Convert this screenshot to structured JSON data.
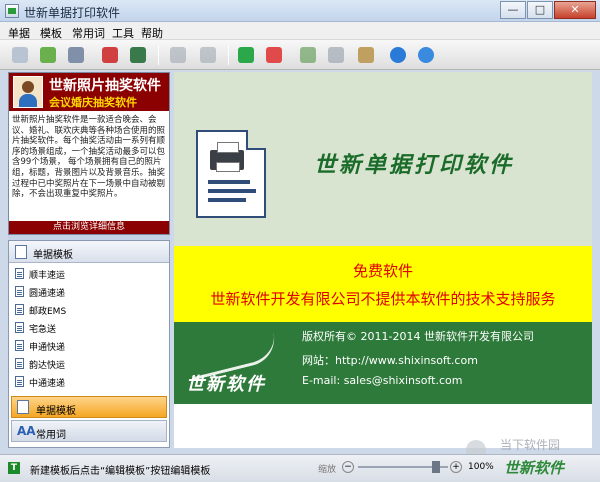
{
  "window": {
    "title": "世新单据打印软件"
  },
  "menu": [
    "单据",
    "模板",
    "常用词",
    "工具",
    "帮助"
  ],
  "toolbar": {
    "icons": [
      "edit-icon",
      "approve-icon",
      "print-icon",
      "delete-red-icon",
      "database-icon",
      "settings-icon",
      "save-icon",
      "add-icon",
      "remove-icon",
      "font-up-icon",
      "font-down-icon",
      "tools-icon",
      "help-icon",
      "web-icon"
    ]
  },
  "sidebar": {
    "product_name": "世新照片抽奖软件",
    "product_subtitle": "会议婚庆抽奖软件",
    "description": "世新照片抽奖软件是一款适合晚会、会议、婚礼、联欢庆典等各种场合使用的照片抽奖软件。每个抽奖活动由一系列有顺序的场景组成，一个抽奖活动最多可以包含99个场景， 每个场景拥有自己的照片组，标题，背景图片以及背景音乐。抽奖过程中已中奖照片在下一场景中自动被剔除，不会出现重复中奖照片。",
    "detail_link": "点击浏览详细信息",
    "list_header": "单据模板",
    "templates": [
      "顺丰速运",
      "圆通速递",
      "邮政EMS",
      "宅急送",
      "申通快递",
      "韵达快运",
      "中通速递"
    ],
    "nav_active": "单据模板",
    "nav_common": "常用词",
    "nav_common_icon": "AA"
  },
  "main": {
    "slogan": "世新单据打印软件",
    "free_text": "免费软件",
    "support_text": "世新软件开发有限公司不提供本软件的技术支持服务",
    "logo_text": "世新软件",
    "copyright": "版权所有© 2011-2014  世新软件开发有限公司",
    "website": "网站：http://www.shixinsoft.com",
    "email": "E-mail: sales@shixinsoft.com"
  },
  "statusbar": {
    "status_text": "新建模板后点击“编辑模板”按钮编辑模板",
    "zoom_label": "缩放",
    "zoom_value": "100%",
    "zoom_level": 0.8
  },
  "watermark": {
    "top": "当下软件园",
    "bottom": "世新软件"
  },
  "colors": {
    "header_red": "#8b0000",
    "slogan_green": "#1b6b2a",
    "banner_yellow": "#ffff00",
    "banner_green": "#2e7a3a",
    "active_orange": "#f5a623"
  }
}
